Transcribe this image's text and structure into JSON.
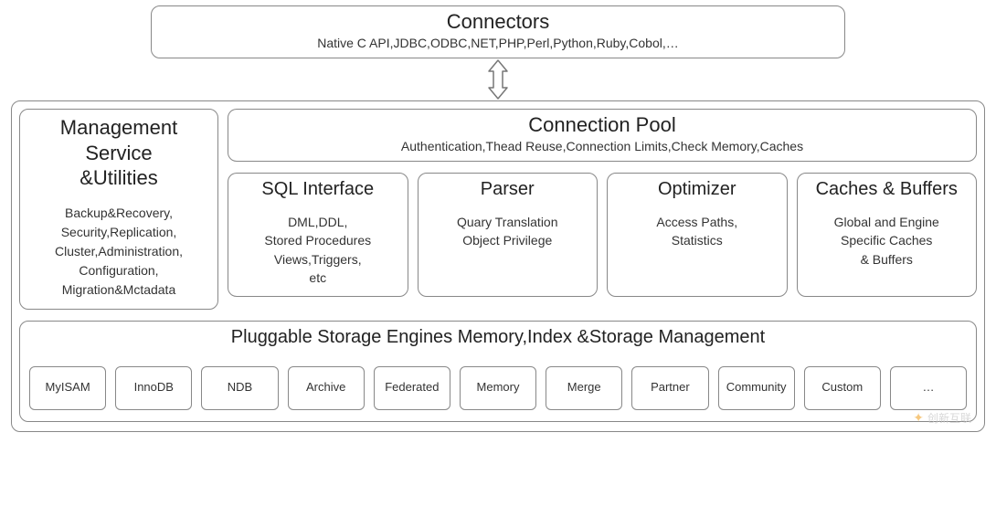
{
  "connectors": {
    "title": "Connectors",
    "subtitle": "Native C API,JDBC,ODBC,NET,PHP,Perl,Python,Ruby,Cobol,…"
  },
  "management": {
    "title_l1": "Management",
    "title_l2": "Service",
    "title_l3": "&Utilities",
    "line1": "Backup&Recovery,",
    "line2": "Security,Replication,",
    "line3": "Cluster,Administration,",
    "line4": "Configuration,",
    "line5": "Migration&Mctadata"
  },
  "pool": {
    "title": "Connection Pool",
    "subtitle": "Authentication,Thead Reuse,Connection Limits,Check Memory,Caches"
  },
  "sql_interface": {
    "title": "SQL Interface",
    "line1": "DML,DDL,",
    "line2": "Stored Procedures",
    "line3": "Views,Triggers,",
    "line4": "etc"
  },
  "parser": {
    "title": "Parser",
    "line1": "Quary Translation",
    "line2": "Object Privilege"
  },
  "optimizer": {
    "title": "Optimizer",
    "line1": "Access Paths,",
    "line2": "Statistics"
  },
  "caches": {
    "title": "Caches & Buffers",
    "line1": "Global and Engine",
    "line2": "Specific Caches",
    "line3": "& Buffers"
  },
  "storage": {
    "title": "Pluggable Storage Engines Memory,Index &Storage Management",
    "engines": [
      "MyISAM",
      "InnoDB",
      "NDB",
      "Archive",
      "Federated",
      "Memory",
      "Merge",
      "Partner",
      "Community",
      "Custom",
      "…"
    ]
  },
  "watermark": "创新互联"
}
